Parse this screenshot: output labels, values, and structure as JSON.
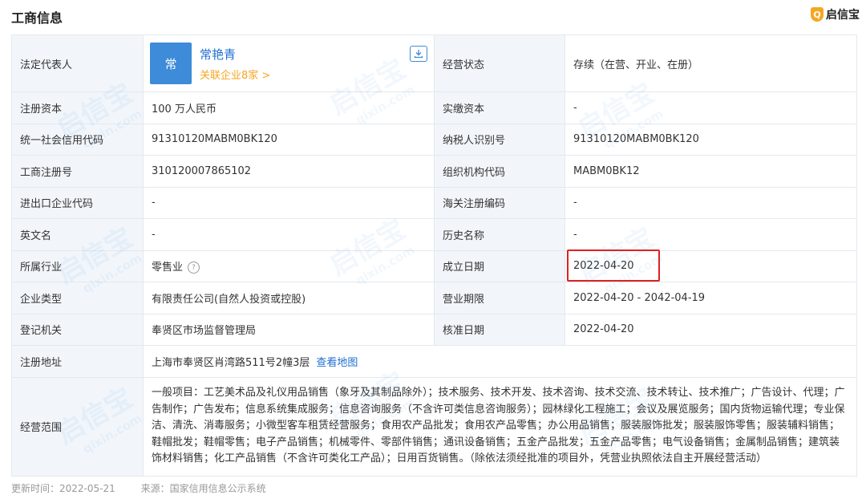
{
  "header": {
    "title": "工商信息",
    "brand": "启信宝",
    "brand_icon": "Q"
  },
  "legal_rep": {
    "label": "法定代表人",
    "avatar_char": "常",
    "name": "常艳青",
    "related": "关联企业8家 >",
    "status_label": "经营状态",
    "status_value": "存续（在营、开业、在册）"
  },
  "rows": [
    {
      "l1": "注册资本",
      "v1": "100 万人民币",
      "l2": "实缴资本",
      "v2": "-"
    },
    {
      "l1": "统一社会信用代码",
      "v1": "91310120MABM0BK120",
      "l2": "纳税人识别号",
      "v2": "91310120MABM0BK120"
    },
    {
      "l1": "工商注册号",
      "v1": "310120007865102",
      "l2": "组织机构代码",
      "v2": "MABM0BK12"
    },
    {
      "l1": "进出口企业代码",
      "v1": "-",
      "l2": "海关注册编码",
      "v2": "-"
    },
    {
      "l1": "英文名",
      "v1": "-",
      "l2": "历史名称",
      "v2": "-"
    },
    {
      "l1": "所属行业",
      "v1": "零售业",
      "l2": "成立日期",
      "v2": "2022-04-20"
    },
    {
      "l1": "企业类型",
      "v1": "有限责任公司(自然人投资或控股)",
      "l2": "营业期限",
      "v2": "2022-04-20 - 2042-04-19"
    },
    {
      "l1": "登记机关",
      "v1": "奉贤区市场监督管理局",
      "l2": "核准日期",
      "v2": "2022-04-20"
    }
  ],
  "address": {
    "label": "注册地址",
    "value": "上海市奉贤区肖湾路511号2幢3层",
    "map_link": "查看地图"
  },
  "scope": {
    "label": "经营范围",
    "value": "一般项目：工艺美术品及礼仪用品销售（象牙及其制品除外）；技术服务、技术开发、技术咨询、技术交流、技术转让、技术推广；广告设计、代理；广告制作；广告发布；信息系统集成服务；信息咨询服务（不含许可类信息咨询服务）；园林绿化工程施工；会议及展览服务；国内货物运输代理；专业保洁、清洗、消毒服务；小微型客车租赁经营服务；食用农产品批发；食用农产品零售；办公用品销售；服装服饰批发；服装服饰零售；服装辅料销售；鞋帽批发；鞋帽零售；电子产品销售；机械零件、零部件销售；通讯设备销售；五金产品批发；五金产品零售；电气设备销售；金属制品销售；建筑装饰材料销售；化工产品销售（不含许可类化工产品）；日用百货销售。（除依法须经批准的项目外，凭营业执照依法自主开展经营活动）"
  },
  "footer": {
    "updated": "更新时间：2022-05-21",
    "source": "来源：国家信用信息公示系统"
  },
  "watermark": {
    "text": "启信宝",
    "sub": "qixin.com"
  },
  "icons": {
    "download": "download-icon",
    "help": "?"
  },
  "colors": {
    "accent": "#1e6fd0",
    "label_bg": "#f2f6fb",
    "highlight": "#e02020",
    "related": "#f5a623"
  }
}
